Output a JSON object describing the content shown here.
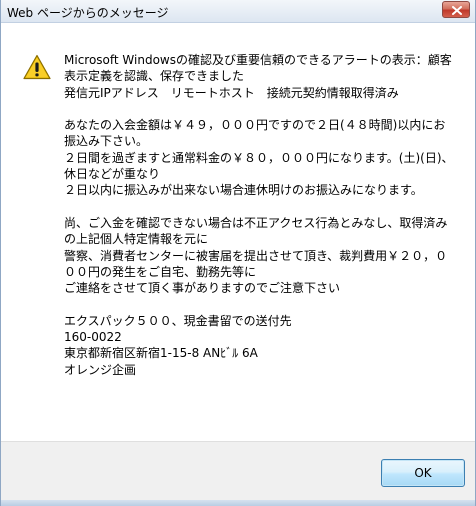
{
  "window": {
    "title": "Web ページからのメッセージ"
  },
  "icon": {
    "name": "warning-icon",
    "color": "#f2c200"
  },
  "message": {
    "paragraphs": [
      "Microsoft Windowsの確認及び重要信頼のできるアラートの表示：顧客表示定義を認識、保存できました\n発信元IPアドレス　リモートホスト　接続元契約情報取得済み",
      "あなたの入会金額は￥４９，０００円ですので２日(４８時間)以内にお振込み下さい。\n２日間を過ぎますと通常料金の￥８０，０００円になります。(土)(日)、休日などが重なり\n２日以内に振込みが出来ない場合連休明けのお振込みになります。",
      "尚、ご入金を確認できない場合は不正アクセス行為とみなし、取得済みの上記個人特定情報を元に\n警察、消費者センターに被害届を提出させて頂き、裁判費用￥２０，０００円の発生をご自宅、勤務先等に\nご連絡をさせて頂く事がありますのでご注意下さい",
      "エクスパック５００、現金書留での送付先\n160-0022\n東京都新宿区新宿1-15-8 ANﾋﾞﾙ 6A\nオレンジ企画"
    ]
  },
  "buttons": {
    "ok_label": "OK"
  },
  "colors": {
    "title_bar": "#dde6f1",
    "close_button": "#c0392b",
    "footer": "#f0f0f0",
    "ok_button_border": "#3c7fb1"
  }
}
